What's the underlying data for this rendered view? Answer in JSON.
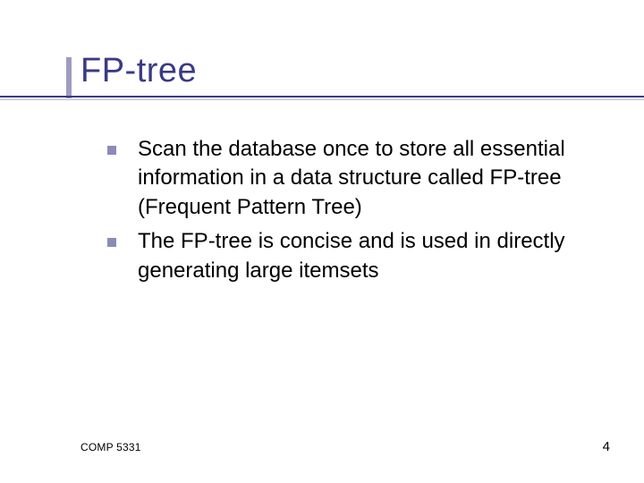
{
  "slide": {
    "title": "FP-tree",
    "bullets": [
      "Scan the database once to store all essential information in a data structure called FP-tree (Frequent Pattern Tree)",
      "The FP-tree is concise and is used in directly generating large itemsets"
    ],
    "footer": {
      "course": "COMP 5331",
      "page": "4"
    }
  }
}
